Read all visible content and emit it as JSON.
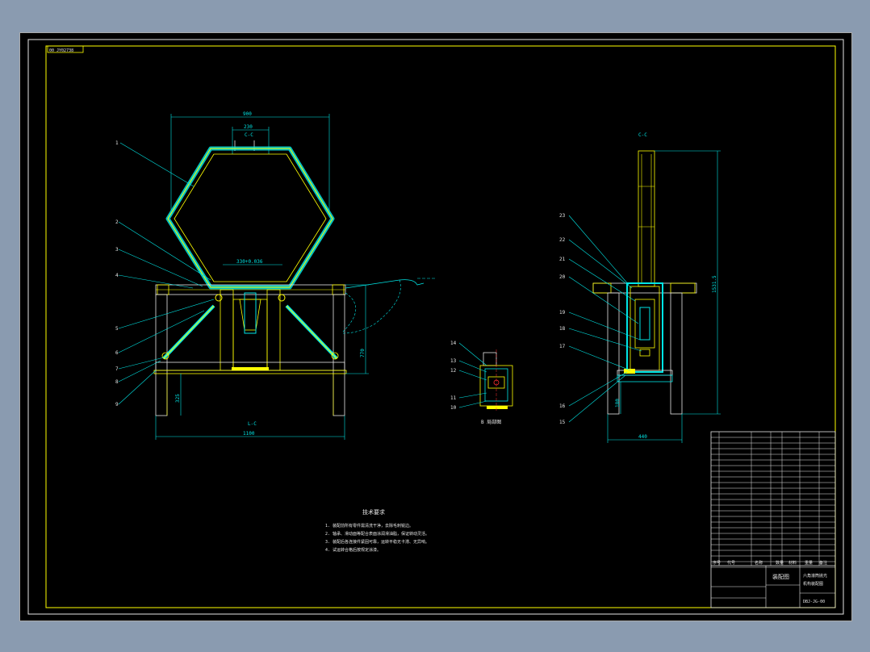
{
  "drawing": {
    "drawing_no_tag": "00 JY02738",
    "dims": {
      "width_top": "900",
      "width_inner": "230",
      "hex_bottom": "330+0.036",
      "height_main": "770",
      "width_base": "1100",
      "small_h": "325",
      "side_height": "1531.5",
      "side_low": "180",
      "side_width": "440"
    },
    "section_marks": {
      "front_cut_top": "C-C",
      "front_cut_bottom": "L-C",
      "side_title": "C-C",
      "detail_title": "B 局部图"
    },
    "balloons_front": [
      "1",
      "2",
      "3",
      "4",
      "5",
      "6",
      "7",
      "8",
      "9"
    ],
    "balloons_detail": [
      "14",
      "13",
      "12",
      "11",
      "10"
    ],
    "balloons_side": [
      "23",
      "22",
      "21",
      "20",
      "19",
      "18",
      "17",
      "16",
      "15"
    ],
    "tech_req": {
      "title": "技术要求",
      "lines": [
        "1. 装配前所有零件需清洗干净，去除毛刺锐边。",
        "2. 轴承、滑动面等配合表面涂润滑油脂，保证转动灵活。",
        "3. 装配后各连接件紧固可靠，运转平稳无卡滞、无异响。",
        "4. 试运转合格后按规定涂漆。"
      ]
    },
    "title_block": {
      "drawing_name": "装配图",
      "product_name_1": "六角滚筒抛光",
      "product_name_2": "机构装配图",
      "drawing_code": "DBJ-JG-00",
      "header": [
        "序号",
        "代号",
        "名称",
        "数量",
        "材料",
        "重量",
        "备注"
      ]
    }
  }
}
